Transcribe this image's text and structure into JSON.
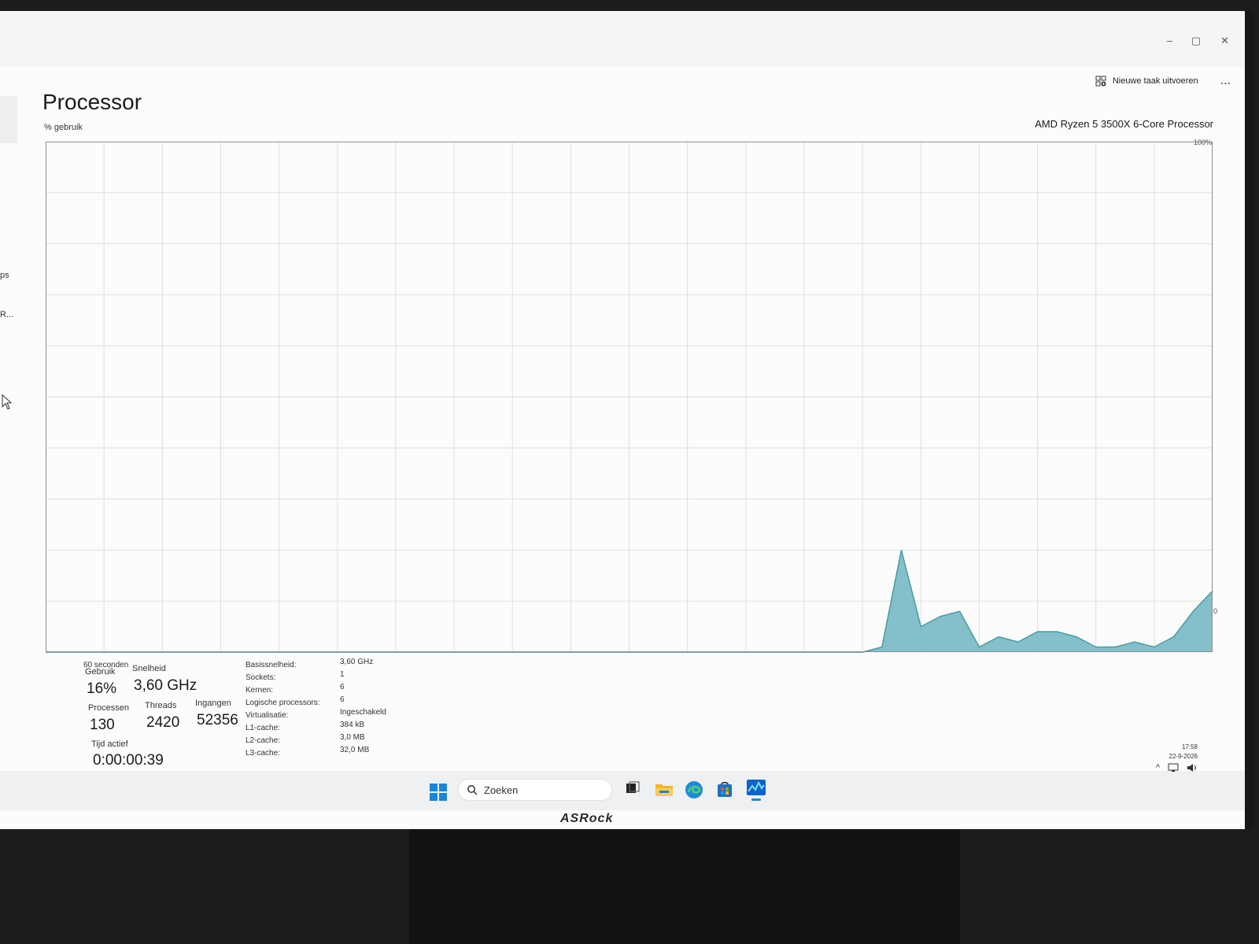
{
  "window": {
    "min": "–",
    "max": "▢",
    "close": "✕"
  },
  "commandbar": {
    "run_new_task": "Nieuwe taak uitvoeren",
    "more": "..."
  },
  "sidebar": {
    "frag_1": "ps",
    "frag_2": "R..."
  },
  "page": {
    "title": "Processor",
    "usage_label": "% gebruik",
    "cpu_name": "AMD Ryzen 5 3500X 6-Core Processor"
  },
  "chart_data": {
    "type": "area",
    "title": "",
    "xlabel": "60 seconden",
    "ylabel": "% gebruik",
    "ymax_label": "100%",
    "ymin_label": "0",
    "ylim": [
      0,
      100
    ],
    "xlim": [
      0,
      60
    ],
    "grid": true,
    "x": [
      0,
      1,
      2,
      3,
      4,
      5,
      6,
      7,
      8,
      9,
      10,
      11,
      12,
      13,
      14,
      15,
      16,
      17,
      18,
      19,
      20,
      21,
      22,
      23,
      24,
      25,
      26,
      27,
      28,
      29,
      30,
      31,
      32,
      33,
      34,
      35,
      36,
      37,
      38,
      39,
      40,
      41,
      42,
      43,
      44,
      45,
      46,
      47,
      48,
      49,
      50,
      51,
      52,
      53,
      54,
      55,
      56,
      57,
      58,
      59,
      60
    ],
    "values": [
      0,
      0,
      0,
      0,
      0,
      0,
      0,
      0,
      0,
      0,
      0,
      0,
      0,
      0,
      0,
      0,
      0,
      0,
      0,
      0,
      0,
      0,
      0,
      0,
      0,
      0,
      0,
      0,
      0,
      0,
      0,
      0,
      0,
      0,
      0,
      0,
      0,
      0,
      0,
      0,
      0,
      0,
      0,
      1,
      20,
      5,
      7,
      8,
      1,
      3,
      2,
      4,
      4,
      3,
      1,
      1,
      2,
      1,
      3,
      8,
      12
    ],
    "color": "#6fb5bf"
  },
  "stats": {
    "usage": {
      "label": "Gebruik",
      "value": "16%"
    },
    "speed": {
      "label": "Snelheid",
      "value": "3,60 GHz"
    },
    "processes": {
      "label": "Processen",
      "value": "130"
    },
    "threads": {
      "label": "Threads",
      "value": "2420"
    },
    "handles": {
      "label": "Ingangen",
      "value": "52356"
    },
    "uptime": {
      "label": "Tijd actief",
      "value": "0:00:00:39"
    }
  },
  "specs": [
    {
      "key": "Basissnelheid:",
      "value": "3,60 GHz"
    },
    {
      "key": "Sockets:",
      "value": "1"
    },
    {
      "key": "Kernen:",
      "value": "6"
    },
    {
      "key": "Logische processors:",
      "value": "6"
    },
    {
      "key": "Virtualisatie:",
      "value": "Ingeschakeld"
    },
    {
      "key": "L1-cache:",
      "value": "384 kB"
    },
    {
      "key": "L2-cache:",
      "value": "3,0 MB"
    },
    {
      "key": "L3-cache:",
      "value": "32,0 MB"
    }
  ],
  "taskbar": {
    "search_placeholder": "Zoeken"
  },
  "clock": {
    "time": "17:58",
    "date": "22-9-2026"
  },
  "bezel": {
    "brand": "ASRock"
  },
  "colors": {
    "accent": "#0078d4",
    "chart_fill": "#6fb5bf",
    "chart_stroke": "#4a9aa6",
    "grid": "#dcdfe2"
  }
}
